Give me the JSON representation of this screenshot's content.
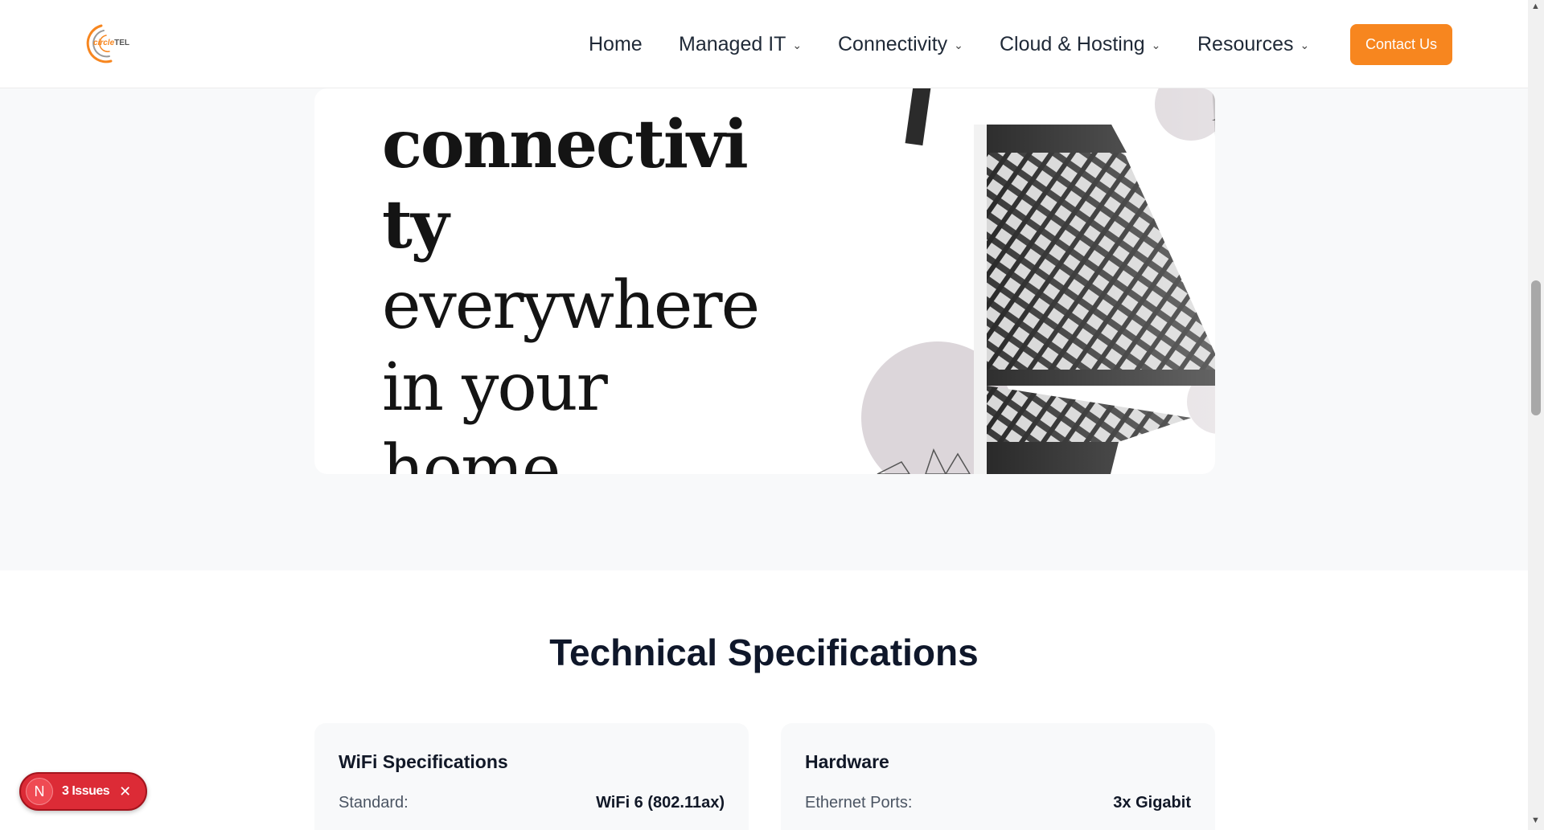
{
  "header": {
    "logo_text_a": "circle",
    "logo_text_b": "TEL",
    "nav": {
      "home": "Home",
      "managed_it": "Managed IT",
      "connectivity": "Connectivity",
      "cloud_hosting": "Cloud & Hosting",
      "resources": "Resources"
    },
    "chevron": "⌄",
    "contact_label": "Contact Us",
    "accent_color": "#f7861f"
  },
  "hero": {
    "line1": "connectivi",
    "line2": "ty",
    "line3": "everywhere",
    "line4": "in your",
    "line5": "home"
  },
  "specs": {
    "title": "Technical Specifications",
    "cards": [
      {
        "heading": "WiFi Specifications",
        "label": "Standard:",
        "value": "WiFi 6 (802.11ax)"
      },
      {
        "heading": "Hardware",
        "label": "Ethernet Ports:",
        "value": "3x Gigabit"
      }
    ]
  },
  "dev_badge": {
    "logo_letter": "N",
    "text": "3 Issues",
    "close": "✕",
    "color": "#dc2b36"
  },
  "scrollbar": {
    "up": "▲",
    "down": "▼"
  }
}
